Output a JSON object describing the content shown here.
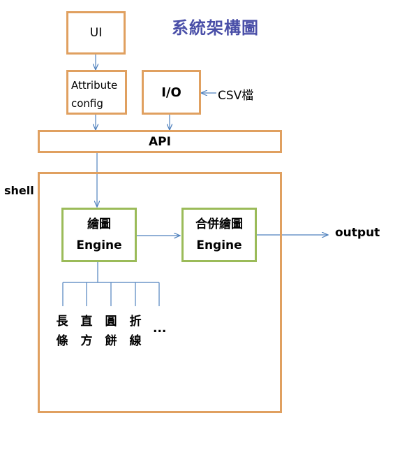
{
  "title": "系統架構圖",
  "ui": {
    "label": "UI"
  },
  "attribute_config": {
    "line1": "Attribute",
    "line2": "config"
  },
  "io": {
    "label": "I/O"
  },
  "csv": {
    "label": "CSV檔"
  },
  "api": {
    "label": "API"
  },
  "shell": {
    "label": "shell"
  },
  "draw_engine": {
    "line1": "繪圖",
    "line2": "Engine"
  },
  "merge_engine": {
    "line1": "合併繪圖",
    "line2": "Engine"
  },
  "output": {
    "label": "output"
  },
  "chart_types": [
    {
      "top": "長",
      "bottom": "條"
    },
    {
      "top": "直",
      "bottom": "方"
    },
    {
      "top": "圓",
      "bottom": "餅"
    },
    {
      "top": "折",
      "bottom": "線"
    }
  ],
  "ellipsis": "...",
  "colors": {
    "orange_border": "#e0a060",
    "green_border": "#9bbb59",
    "arrow": "#4f81bd",
    "title": "#4a4fa8"
  }
}
